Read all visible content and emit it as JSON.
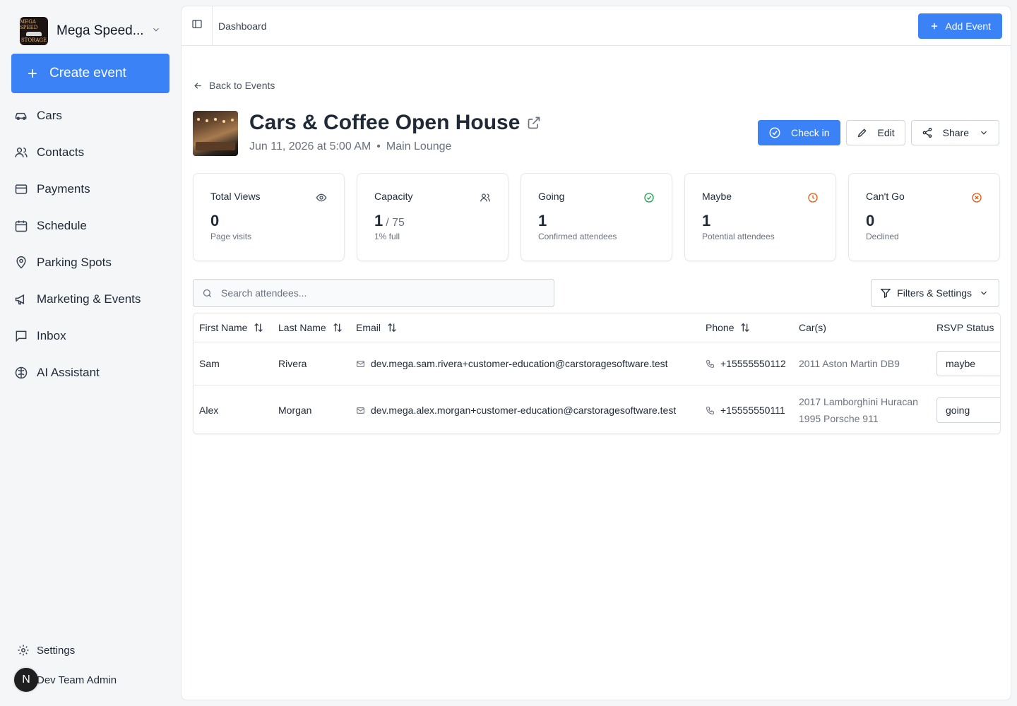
{
  "brand": {
    "name": "Mega Speed...",
    "logo_text_top": "MEGA SPEED",
    "logo_text_bottom": "STORAGE"
  },
  "sidebar": {
    "create_label": "Create event",
    "items": [
      {
        "label": "Cars",
        "icon": "car-icon"
      },
      {
        "label": "Contacts",
        "icon": "users-icon"
      },
      {
        "label": "Payments",
        "icon": "credit-card-icon"
      },
      {
        "label": "Schedule",
        "icon": "calendar-icon"
      },
      {
        "label": "Parking Spots",
        "icon": "map-pin-icon"
      },
      {
        "label": "Marketing & Events",
        "icon": "megaphone-icon"
      },
      {
        "label": "Inbox",
        "icon": "message-square-icon"
      },
      {
        "label": "AI Assistant",
        "icon": "brain-icon"
      }
    ],
    "settings_label": "Settings",
    "user": {
      "initial": "N",
      "name": "Dev Team Admin"
    }
  },
  "topbar": {
    "breadcrumb": "Dashboard",
    "add_event_label": "Add Event"
  },
  "event": {
    "back_label": "Back to Events",
    "title": "Cars & Coffee Open House",
    "date": "Jun 11, 2026 at 5:00 AM",
    "separator": "•",
    "location": "Main Lounge",
    "actions": {
      "check_in": "Check in",
      "edit": "Edit",
      "share": "Share"
    }
  },
  "stats": [
    {
      "label": "Total Views",
      "value": "0",
      "desc": "Page visits",
      "icon": "eye-icon"
    },
    {
      "label": "Capacity",
      "value": "1",
      "of": "/ 75",
      "desc": "1% full",
      "icon": "users-icon"
    },
    {
      "label": "Going",
      "value": "1",
      "desc": "Confirmed attendees",
      "icon": "check-circle-icon",
      "color": "#16a34a"
    },
    {
      "label": "Maybe",
      "value": "1",
      "desc": "Potential attendees",
      "icon": "clock-icon",
      "color": "#ea580c"
    },
    {
      "label": "Can't Go",
      "value": "0",
      "desc": "Declined",
      "icon": "x-circle-icon",
      "color": "#ea580c"
    }
  ],
  "search": {
    "placeholder": "Search attendees..."
  },
  "filters_label": "Filters & Settings",
  "table": {
    "columns": [
      "First Name",
      "Last Name",
      "Email",
      "Phone",
      "Car(s)",
      "RSVP Status"
    ],
    "rows": [
      {
        "first": "Sam",
        "last": "Rivera",
        "email": "dev.mega.sam.rivera+customer-education@carstoragesoftware.test",
        "phone": "+15555550112",
        "cars": [
          "2011 Aston Martin DB9"
        ],
        "rsvp": "maybe"
      },
      {
        "first": "Alex",
        "last": "Morgan",
        "email": "dev.mega.alex.morgan+customer-education@carstoragesoftware.test",
        "phone": "+15555550111",
        "cars": [
          "2017 Lamborghini Huracan",
          "1995 Porsche 911"
        ],
        "rsvp": "going"
      }
    ]
  },
  "colors": {
    "accent": "#3b82f6",
    "going": "#16a34a",
    "maybe": "#ea580c",
    "cant_go": "#ea580c"
  }
}
